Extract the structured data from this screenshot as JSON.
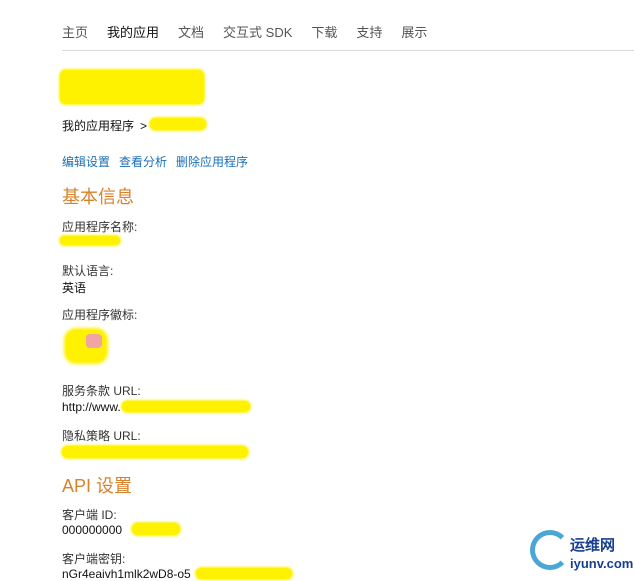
{
  "nav": [
    "主页",
    "我的应用",
    "文档",
    "交互式 SDK",
    "下载",
    "支持",
    "展示"
  ],
  "nav_active_index": 1,
  "breadcrumb": {
    "root": "我的应用程序",
    "separator": ">"
  },
  "actions": [
    "编辑设置",
    "查看分析",
    "删除应用程序"
  ],
  "basic_info": {
    "title": "基本信息",
    "app_name_label": "应用程序名称:",
    "language_label": "默认语言:",
    "language_value": "英语",
    "icon_label": "应用程序徽标:",
    "tos_label": "服务条款 URL:",
    "tos_value": "http://www.",
    "privacy_label": "隐私策略 URL:"
  },
  "api": {
    "title": "API 设置",
    "client_id_label": "客户端 ID:",
    "client_id_value": "000000000",
    "client_secret_label": "客户端密钥:",
    "client_secret_value": "nGr4eaivh1mlk2wD8-o5"
  },
  "watermark": {
    "cn": "运维网",
    "en": "iyunv.com"
  },
  "colors": {
    "accent_orange": "#d9822b",
    "link_blue": "#1a6fb5",
    "redaction": "#fff200"
  }
}
